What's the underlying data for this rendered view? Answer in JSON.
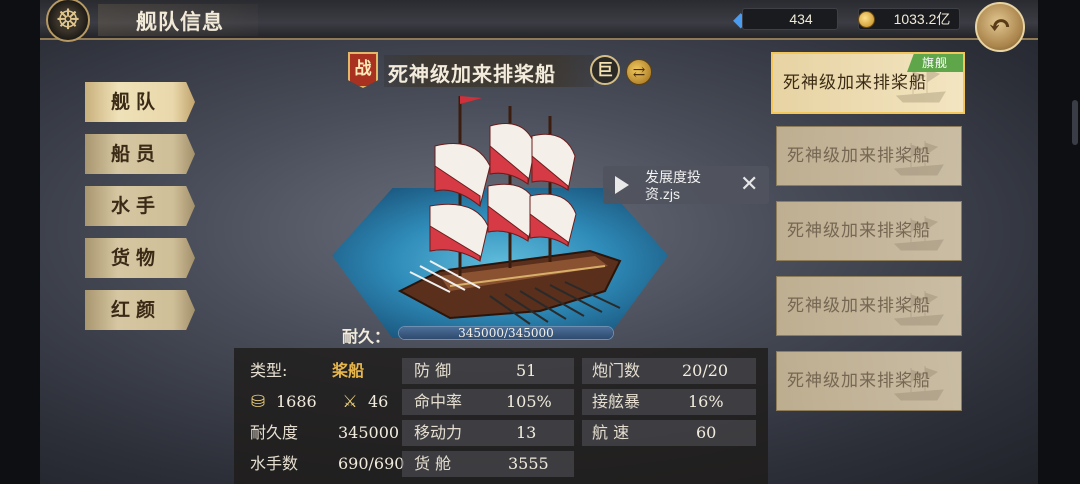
{
  "header": {
    "title": "舰队信息",
    "gems": "434",
    "gold": "1033.2亿",
    "wheel_icon": "ship-wheel-icon",
    "back_icon": "back-arrow-icon"
  },
  "nav": {
    "items": [
      {
        "label": "舰队",
        "active": true
      },
      {
        "label": "船员",
        "active": false
      },
      {
        "label": "水手",
        "active": false
      },
      {
        "label": "货物",
        "active": false
      },
      {
        "label": "红颜",
        "active": false
      }
    ]
  },
  "ship": {
    "battle_badge": "战",
    "name": "死神级加来排桨船",
    "size_badge": "巨",
    "durability_label": "耐久：",
    "durability_text": "345000/345000",
    "durability_fraction": 1.0
  },
  "video": {
    "title": "发展度投资.zjs",
    "close": "✕"
  },
  "fleet": {
    "flag_label": "旗舰",
    "cards": [
      {
        "name": "死神级加来排桨船",
        "active": true
      },
      {
        "name": "死神级加来排桨船",
        "active": false
      },
      {
        "name": "死神级加来排桨船",
        "active": false
      },
      {
        "name": "死神级加来排桨船",
        "active": false
      },
      {
        "name": "死神级加来排桨船",
        "active": false
      }
    ]
  },
  "stats": {
    "type_label": "类型:",
    "type_value": "桨船",
    "cargo_icon_value": "1686",
    "attack_icon_value": "46",
    "durability_label": "耐久度",
    "durability_value": "345000",
    "sailors_label": "水手数",
    "sailors_value": "690/690",
    "defense_label": "防 御",
    "defense_value": "51",
    "accuracy_label": "命中率",
    "accuracy_value": "105%",
    "mobility_label": "移动力",
    "mobility_value": "13",
    "hold_label": "货 舱",
    "hold_value": "3555",
    "cannon_label": "炮门数",
    "cannon_value": "20/20",
    "boarding_label": "接舷暴",
    "boarding_value": "16%",
    "speed_label": "航 速",
    "speed_value": "60"
  },
  "colors": {
    "accent_gold": "#e8b74c",
    "flagship_tag": "#5fa64b",
    "battle_badge": "#a8321f",
    "sea": "#2b8fbf"
  }
}
